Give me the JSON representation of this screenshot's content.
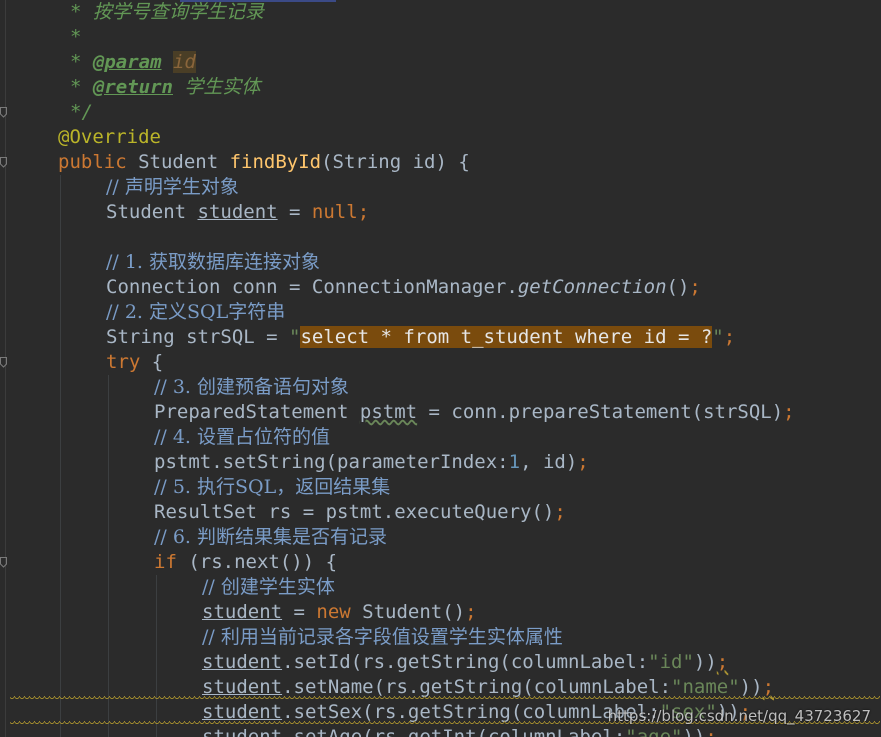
{
  "lines": [
    {
      "indent": 70,
      "tokens": [
        {
          "t": "* 按学号查询学生记录",
          "c": "doc"
        }
      ]
    },
    {
      "indent": 70,
      "tokens": [
        {
          "t": "*",
          "c": "doc"
        }
      ]
    },
    {
      "indent": 70,
      "tokens": [
        {
          "t": "* ",
          "c": "doc"
        },
        {
          "t": "@param",
          "c": "doctag"
        },
        {
          "t": " ",
          "c": "doc"
        },
        {
          "t": "id",
          "c": "docvar"
        }
      ]
    },
    {
      "indent": 70,
      "tokens": [
        {
          "t": "* ",
          "c": "doc"
        },
        {
          "t": "@return",
          "c": "doctag"
        },
        {
          "t": " 学生实体",
          "c": "doc"
        }
      ]
    },
    {
      "indent": 70,
      "tokens": [
        {
          "t": "*/",
          "c": "doc"
        }
      ]
    },
    {
      "indent": 58,
      "tokens": [
        {
          "t": "@Override",
          "c": "ann"
        }
      ]
    },
    {
      "indent": 58,
      "tokens": [
        {
          "t": "public ",
          "c": "kw"
        },
        {
          "t": "Student ",
          "c": "plain"
        },
        {
          "t": "findById",
          "c": "fn"
        },
        {
          "t": "(String id) {",
          "c": "plain"
        }
      ]
    },
    {
      "indent": 106,
      "tokens": [
        {
          "t": "// 声明学生对象",
          "c": "cn"
        }
      ]
    },
    {
      "indent": 106,
      "tokens": [
        {
          "t": "Student ",
          "c": "plain"
        },
        {
          "t": "student",
          "c": "underline"
        },
        {
          "t": " = ",
          "c": "plain"
        },
        {
          "t": "null",
          "c": "kw"
        },
        {
          "t": ";",
          "c": "kw"
        }
      ]
    },
    {
      "indent": 106,
      "tokens": []
    },
    {
      "indent": 106,
      "tokens": [
        {
          "t": "// 1. 获取数据库连接对象",
          "c": "cn"
        }
      ]
    },
    {
      "indent": 106,
      "tokens": [
        {
          "t": "Connection conn = ConnectionManager.",
          "c": "plain"
        },
        {
          "t": "getConnection",
          "c": "italic"
        },
        {
          "t": "()",
          "c": "plain"
        },
        {
          "t": ";",
          "c": "kw"
        }
      ]
    },
    {
      "indent": 106,
      "tokens": [
        {
          "t": "// 2. 定义SQL字符串",
          "c": "cn"
        }
      ]
    },
    {
      "indent": 106,
      "tokens": [
        {
          "t": "String strSQL = ",
          "c": "plain"
        },
        {
          "t": "\"",
          "c": "str"
        },
        {
          "t": "select * from t_student where id = ?",
          "c": "highlight"
        },
        {
          "t": "\"",
          "c": "str"
        },
        {
          "t": ";",
          "c": "kw"
        }
      ]
    },
    {
      "indent": 106,
      "tokens": [
        {
          "t": "try",
          "c": "kw"
        },
        {
          "t": " {",
          "c": "plain"
        }
      ]
    },
    {
      "indent": 154,
      "tokens": [
        {
          "t": "// 3. 创建预备语句对象",
          "c": "cn"
        }
      ]
    },
    {
      "indent": 154,
      "tokens": [
        {
          "t": "PreparedStatement ",
          "c": "plain"
        },
        {
          "t": "pstmt",
          "c": "wavy"
        },
        {
          "t": " = conn.prepareStatement(strSQL)",
          "c": "plain"
        },
        {
          "t": ";",
          "c": "kw"
        }
      ]
    },
    {
      "indent": 154,
      "tokens": [
        {
          "t": "// 4. 设置占位符的值",
          "c": "cn"
        }
      ]
    },
    {
      "indent": 154,
      "tokens": [
        {
          "t": "pstmt.setString(",
          "c": "plain"
        },
        {
          "t": "parameterIndex:",
          "c": "hint"
        },
        {
          "t": "1",
          "c": "num"
        },
        {
          "t": ", id)",
          "c": "plain"
        },
        {
          "t": ";",
          "c": "kw"
        }
      ]
    },
    {
      "indent": 154,
      "tokens": [
        {
          "t": "// 5. 执行SQL，返回结果集",
          "c": "cn"
        }
      ]
    },
    {
      "indent": 154,
      "tokens": [
        {
          "t": "ResultSet rs = pstmt.executeQuery()",
          "c": "plain"
        },
        {
          "t": ";",
          "c": "kw"
        }
      ]
    },
    {
      "indent": 154,
      "tokens": [
        {
          "t": "// 6. 判断结果集是否有记录",
          "c": "cn"
        }
      ]
    },
    {
      "indent": 154,
      "tokens": [
        {
          "t": "if",
          "c": "kw"
        },
        {
          "t": " (rs.next()) {",
          "c": "plain"
        }
      ]
    },
    {
      "indent": 202,
      "tokens": [
        {
          "t": "// 创建学生实体",
          "c": "cn"
        }
      ]
    },
    {
      "indent": 202,
      "tokens": [
        {
          "t": "student",
          "c": "underline"
        },
        {
          "t": " = ",
          "c": "plain"
        },
        {
          "t": "new ",
          "c": "kw"
        },
        {
          "t": "Student()",
          "c": "plain"
        },
        {
          "t": ";",
          "c": "kw"
        }
      ]
    },
    {
      "indent": 202,
      "tokens": [
        {
          "t": "// 利用当前记录各字段值设置学生实体属性",
          "c": "cn"
        }
      ]
    },
    {
      "indent": 202,
      "tokens": [
        {
          "t": "student",
          "c": "underline"
        },
        {
          "t": ".setId(rs.getString(",
          "c": "plain"
        },
        {
          "t": "columnLabel:",
          "c": "hint"
        },
        {
          "t": "\"id\"",
          "c": "str"
        },
        {
          "t": "))",
          "c": "plain"
        },
        {
          "t": ";",
          "c": "warnsemi"
        }
      ]
    },
    {
      "indent": 202,
      "tokens": [
        {
          "t": "student",
          "c": "underline"
        },
        {
          "t": ".setName(rs.getString(",
          "c": "plain"
        },
        {
          "t": "columnLabel:",
          "c": "hint"
        },
        {
          "t": "\"name\"",
          "c": "str"
        },
        {
          "t": "))",
          "c": "plain"
        },
        {
          "t": ";",
          "c": "warnsemi"
        }
      ]
    },
    {
      "indent": 202,
      "tokens": [
        {
          "t": "student",
          "c": "underline"
        },
        {
          "t": ".setSex(rs.getString(",
          "c": "plain"
        },
        {
          "t": "columnLabel:",
          "c": "hint"
        },
        {
          "t": "\"sex\"",
          "c": "str"
        },
        {
          "t": "))",
          "c": "plain"
        },
        {
          "t": ";",
          "c": "kw"
        }
      ]
    },
    {
      "indent": 202,
      "tokens": [
        {
          "t": "student",
          "c": "underline"
        },
        {
          "t": ".setAge(rs.getInt(",
          "c": "plain"
        },
        {
          "t": "columnLabel:",
          "c": "hint"
        },
        {
          "t": "\"age\"",
          "c": "str"
        },
        {
          "t": "))",
          "c": "plain"
        },
        {
          "t": ";",
          "c": "kw"
        }
      ]
    }
  ],
  "watermark": "https://blog.csdn.net/qq_43723627",
  "colors": {
    "background": "#2b2b2b",
    "keyword": "#cc7832",
    "method": "#ffc66d",
    "string": "#6a8759",
    "number": "#6897bb",
    "annotation": "#bbb529",
    "comment": "#7a9cc7",
    "javadoc": "#629755",
    "sql_highlight": "#7a4b0d",
    "inlay_hint_bg": "#4b4e50"
  }
}
